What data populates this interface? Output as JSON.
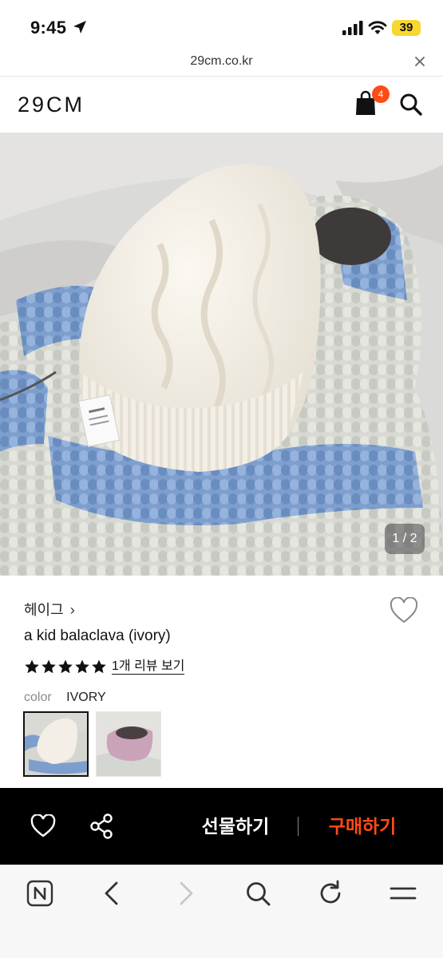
{
  "status_bar": {
    "time": "9:45",
    "battery": "39"
  },
  "browser": {
    "url": "29cm.co.kr"
  },
  "header": {
    "logo": "29CM",
    "cart_count": "4"
  },
  "gallery": {
    "counter": "1 / 2"
  },
  "product": {
    "brand": "헤이그",
    "brand_chevron": "›",
    "name": "a kid balaclava (ivory)",
    "rating": 5,
    "review_link": "1개 리뷰 보기",
    "color_label": "color",
    "color_value": "IVORY"
  },
  "actions": {
    "gift_label": "선물하기",
    "buy_label": "구매하기"
  },
  "colors": {
    "accent": "#ff4b14",
    "action_bar_bg": "#000000",
    "star": "#111111"
  },
  "icons": {
    "status": [
      "location-arrow-icon",
      "signal-icon",
      "wifi-icon"
    ],
    "header": [
      "cart-icon",
      "search-icon"
    ],
    "action_bar": [
      "heart-icon",
      "share-icon"
    ],
    "browser_toolbar": [
      "naver-icon",
      "back-icon",
      "forward-icon",
      "search-icon",
      "reload-icon",
      "menu-icon"
    ]
  }
}
